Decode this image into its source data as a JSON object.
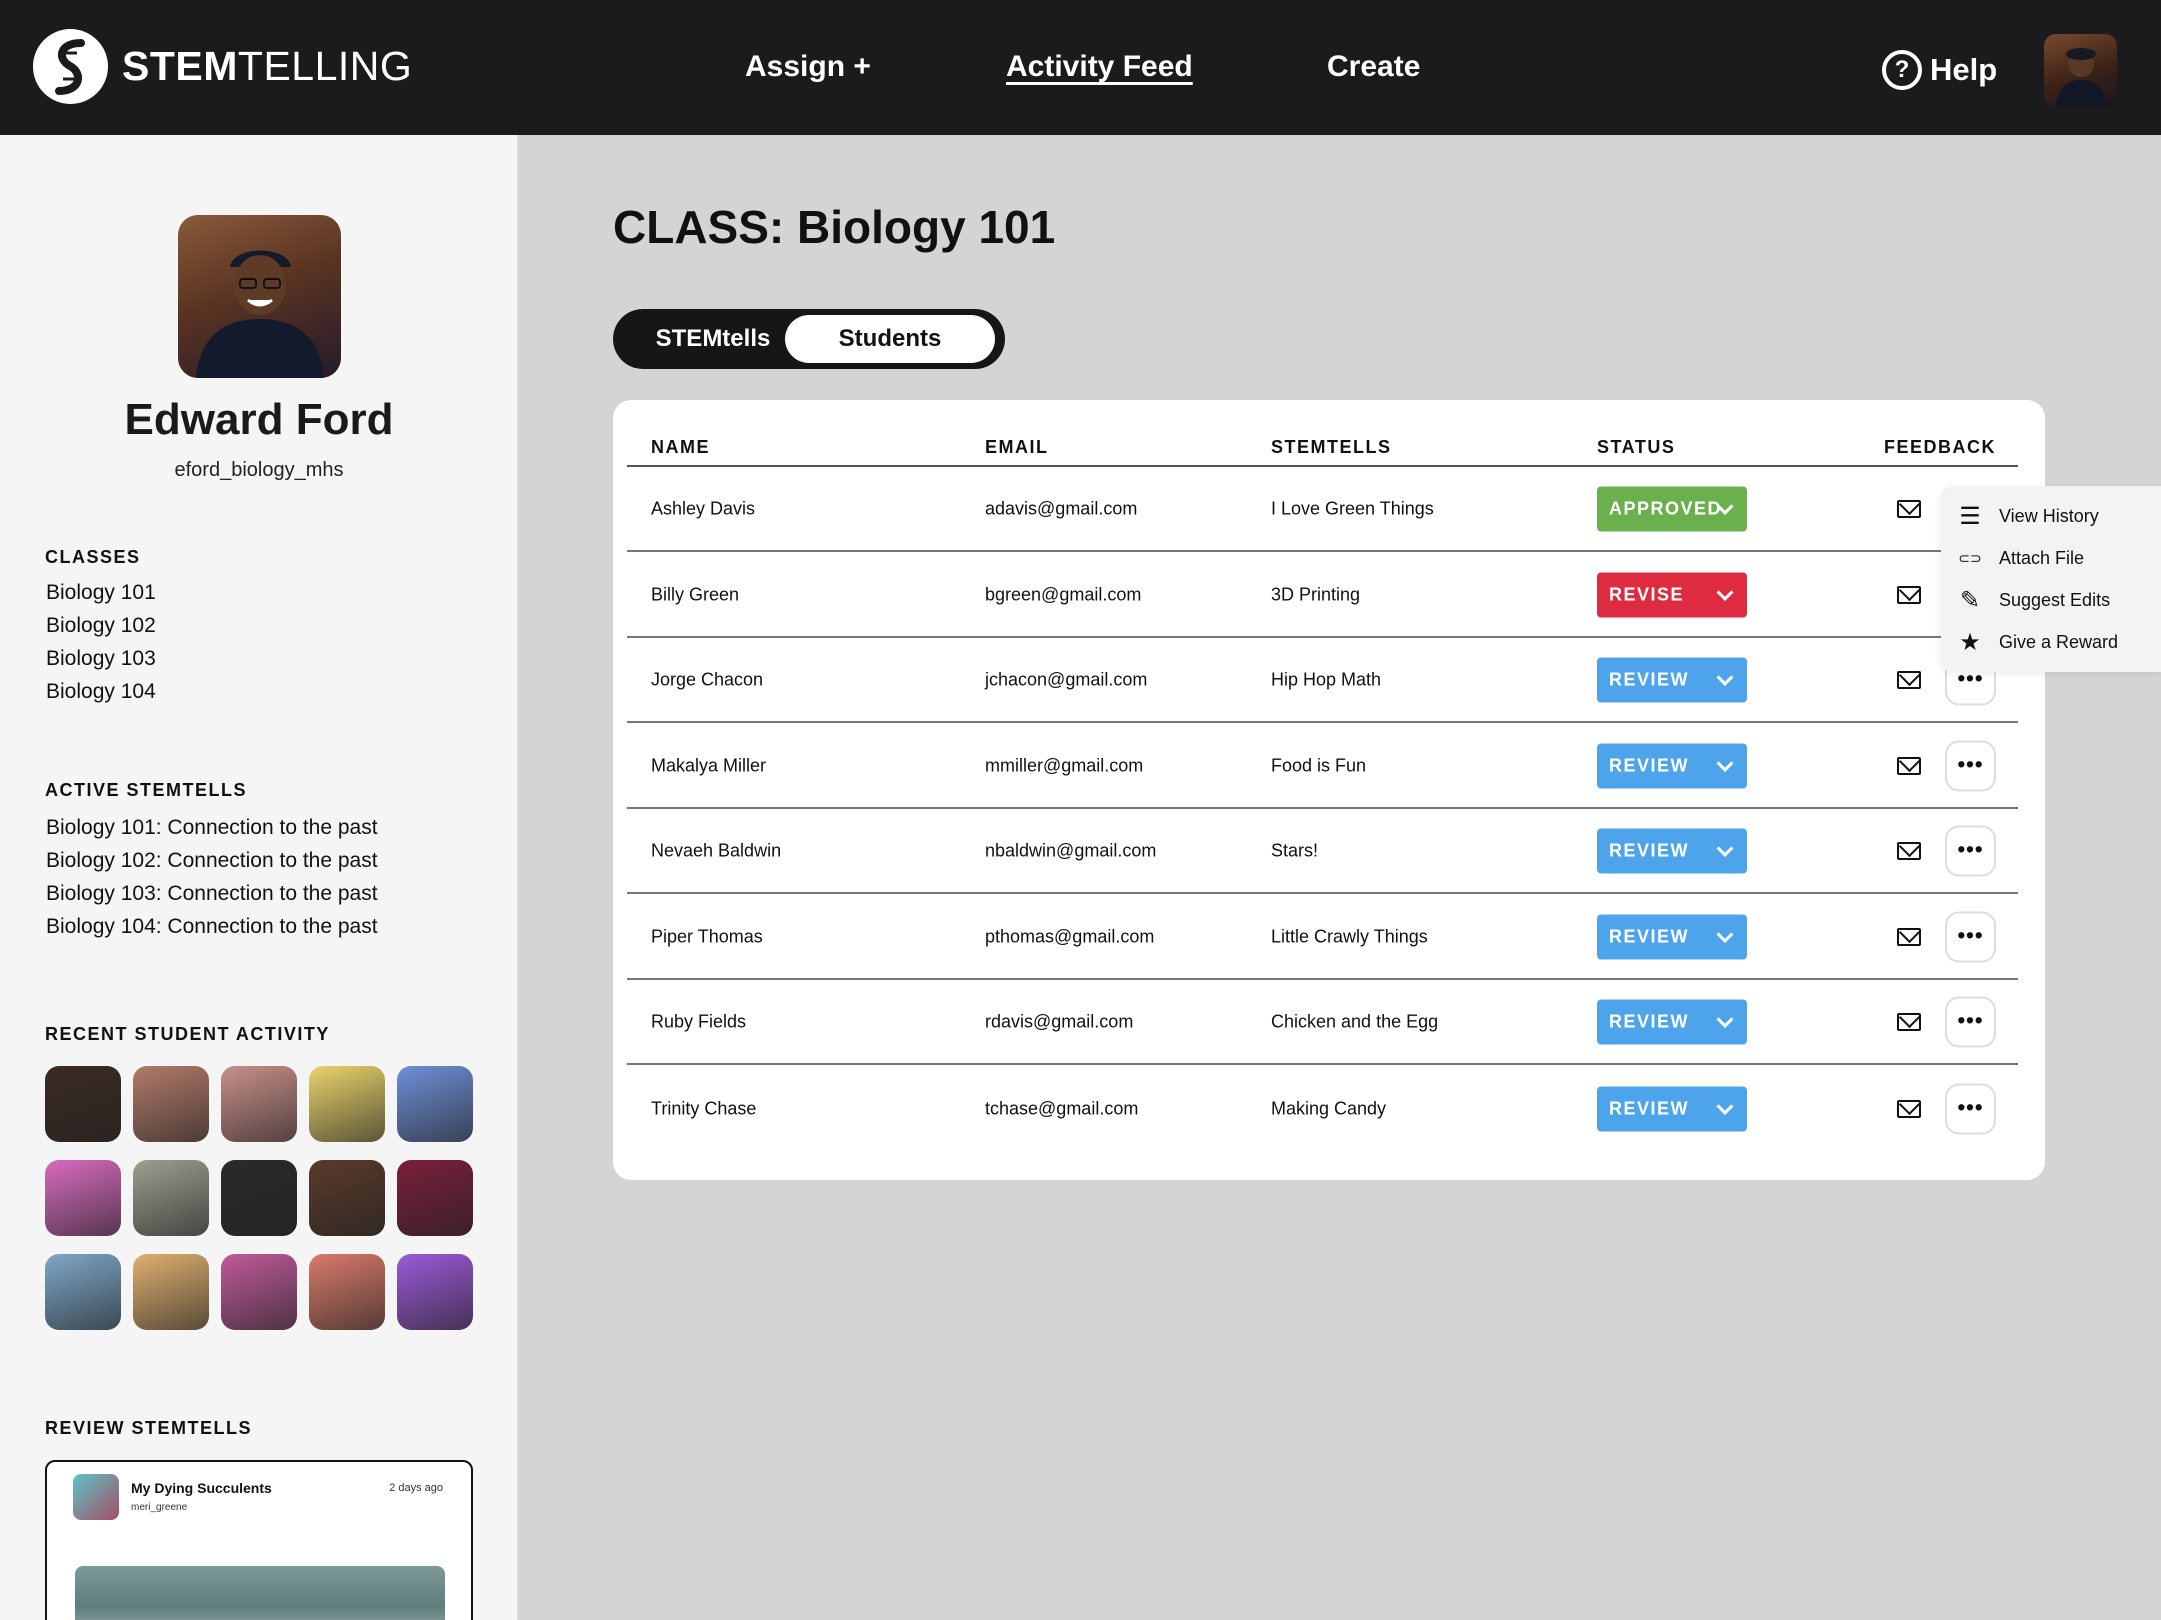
{
  "app": {
    "logo_bold": "STEM",
    "logo_light": "TELLING"
  },
  "nav": {
    "assign": "Assign +",
    "activity_feed": "Activity Feed",
    "create": "Create",
    "help": "Help",
    "help_icon": "?"
  },
  "profile": {
    "name": "Edward Ford",
    "handle": "eford_biology_mhs"
  },
  "sidebar": {
    "classes_title": "CLASSES",
    "classes": [
      "Biology 101",
      "Biology 102",
      "Biology 103",
      "Biology 104"
    ],
    "active_title": "ACTIVE STEMTELLS",
    "active": [
      "Biology 101: Connection to the past",
      "Biology 102: Connection to the past",
      "Biology 103: Connection to the past",
      "Biology 104: Connection to the past"
    ],
    "recent_title": "RECENT STUDENT ACTIVITY",
    "recent_colors": [
      "#3b2a22",
      "#b37a6a",
      "#c98f8a",
      "#e9d46b",
      "#6e8fd8",
      "#d86bbf",
      "#9aa08f",
      "#2a2a2a",
      "#5a3a2a",
      "#7a1f3a",
      "#7ea7c8",
      "#e0b070",
      "#c05a9a",
      "#d97a6a",
      "#9b5ad8"
    ],
    "review_title": "REVIEW STEMTELLS",
    "review_card": {
      "title": "My Dying Succulents",
      "user": "meri_greene",
      "time": "2 days ago"
    }
  },
  "main": {
    "title": "CLASS: Biology 101",
    "toggle": {
      "stemtells": "STEMtells",
      "students": "Students"
    },
    "columns": {
      "name": "NAME",
      "email": "EMAIL",
      "stemtells": "STEMTELLS",
      "status": "STATUS",
      "feedback": "FEEDBACK"
    },
    "more_glyph": "•••",
    "rows": [
      {
        "name": "Ashley Davis",
        "email": "adavis@gmail.com",
        "stemtell": "I Love Green Things",
        "status": "APPROVED",
        "status_color": "#6ab04c"
      },
      {
        "name": "Billy Green",
        "email": "bgreen@gmail.com",
        "stemtell": "3D Printing",
        "status": "REVISE",
        "status_color": "#df2b40"
      },
      {
        "name": "Jorge Chacon",
        "email": "jchacon@gmail.com",
        "stemtell": "Hip Hop Math",
        "status": "REVIEW",
        "status_color": "#4ea4ea"
      },
      {
        "name": "Makalya Miller",
        "email": "mmiller@gmail.com",
        "stemtell": "Food is Fun",
        "status": "REVIEW",
        "status_color": "#4ea4ea"
      },
      {
        "name": "Nevaeh Baldwin",
        "email": "nbaldwin@gmail.com",
        "stemtell": "Stars!",
        "status": "REVIEW",
        "status_color": "#4ea4ea"
      },
      {
        "name": "Piper Thomas",
        "email": "pthomas@gmail.com",
        "stemtell": "Little Crawly Things",
        "status": "REVIEW",
        "status_color": "#4ea4ea"
      },
      {
        "name": "Ruby Fields",
        "email": "rdavis@gmail.com",
        "stemtell": "Chicken and the Egg",
        "status": "REVIEW",
        "status_color": "#4ea4ea"
      },
      {
        "name": "Trinity Chase",
        "email": "tchase@gmail.com",
        "stemtell": "Making Candy",
        "status": "REVIEW",
        "status_color": "#4ea4ea"
      }
    ]
  },
  "context_menu": {
    "items": [
      {
        "label": "View History",
        "icon": "list-icon",
        "glyph": "☰"
      },
      {
        "label": "Attach File",
        "icon": "paperclip-icon",
        "glyph": "⊂⊃"
      },
      {
        "label": "Suggest Edits",
        "icon": "pencil-icon",
        "glyph": "✎"
      },
      {
        "label": "Give a Reward",
        "icon": "star-icon",
        "glyph": "★"
      }
    ]
  }
}
